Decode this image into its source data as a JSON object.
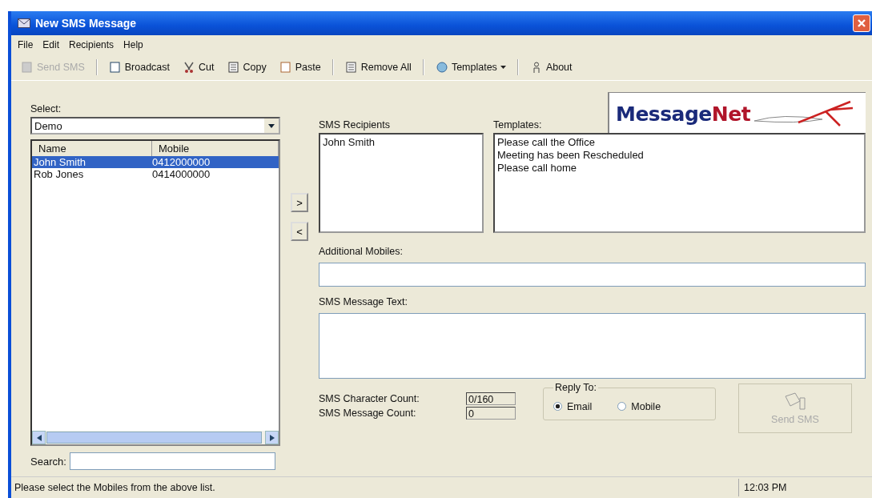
{
  "window": {
    "title": "New SMS Message"
  },
  "menu": [
    "File",
    "Edit",
    "Recipients",
    "Help"
  ],
  "toolbar": [
    [
      {
        "label": "Send SMS",
        "disabled": true,
        "dropdown": false
      }
    ],
    [
      {
        "label": "Broadcast",
        "disabled": false,
        "dropdown": false
      },
      {
        "label": "Cut",
        "disabled": false,
        "dropdown": false
      },
      {
        "label": "Copy",
        "disabled": false,
        "dropdown": false
      },
      {
        "label": "Paste",
        "disabled": false,
        "dropdown": false
      }
    ],
    [
      {
        "label": "Remove All",
        "disabled": false,
        "dropdown": false
      }
    ],
    [
      {
        "label": "Templates",
        "disabled": false,
        "dropdown": true
      }
    ],
    [
      {
        "label": "About",
        "disabled": false,
        "dropdown": false
      }
    ]
  ],
  "select": {
    "label": "Select:",
    "value": "Demo"
  },
  "contacts": {
    "columns": [
      "Name",
      "Mobile"
    ],
    "rows": [
      {
        "name": "John Smith",
        "mobile": "0412000000",
        "selected": true
      },
      {
        "name": "Rob Jones",
        "mobile": "0414000000",
        "selected": false
      }
    ]
  },
  "search": {
    "label": "Search:"
  },
  "move_buttons": [
    ">",
    "<"
  ],
  "logo": {
    "parts": [
      "Message",
      "Net"
    ]
  },
  "recipients": {
    "label": "SMS Recipients",
    "items": [
      "John Smith"
    ]
  },
  "templates": {
    "label": "Templates:",
    "items": [
      "Please call the Office",
      "Meeting has been Rescheduled",
      "Please call home"
    ]
  },
  "additional_mobiles": {
    "label": "Additional Mobiles:"
  },
  "message_text": {
    "label": "SMS Message Text:"
  },
  "counts": [
    {
      "label": "SMS Character Count:",
      "value": "0/160"
    },
    {
      "label": "SMS Message Count:",
      "value": "0"
    }
  ],
  "reply_to": {
    "label": "Reply To:",
    "options": [
      {
        "label": "Email",
        "selected": true
      },
      {
        "label": "Mobile",
        "selected": false
      }
    ]
  },
  "send_button": {
    "label": "Send SMS",
    "disabled": true
  },
  "status_bar": {
    "message": "Please select the Mobiles from the above list.",
    "time": "12:03 PM"
  }
}
